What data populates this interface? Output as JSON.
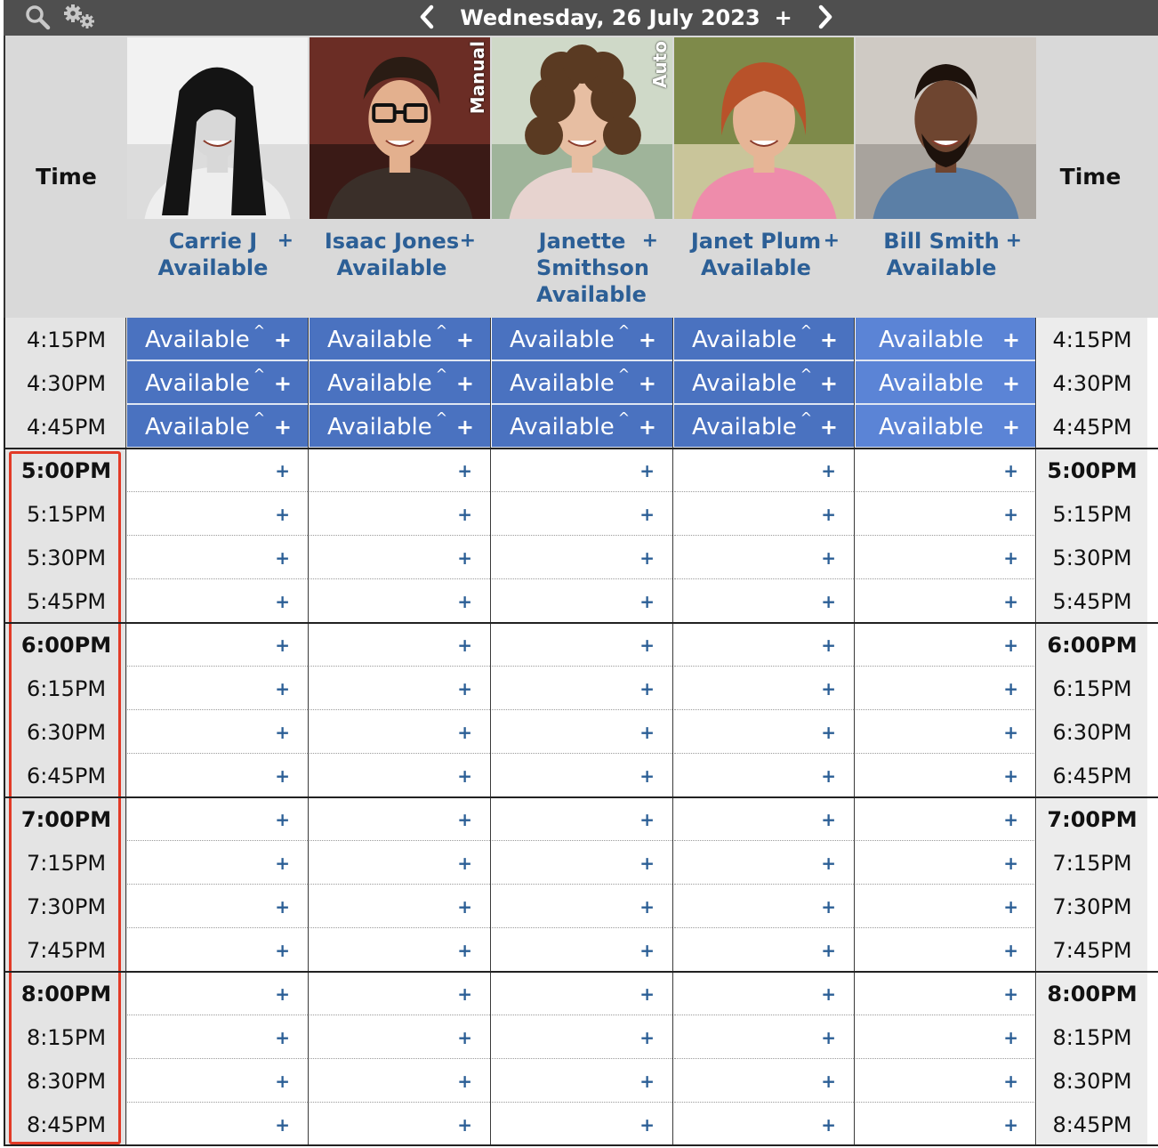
{
  "toolbar": {
    "date": "Wednesday, 26 July 2023",
    "add_label": "+",
    "prev_icon": "chevron-left-icon",
    "next_icon": "chevron-right-icon",
    "search_icon": "search-icon",
    "settings_icon": "gears-icon"
  },
  "header": {
    "time_left": "Time",
    "time_right": "Time"
  },
  "staff": [
    {
      "name": "Carrie J",
      "status": "Available",
      "tag": "",
      "plus": "+"
    },
    {
      "name": "Isaac Jones",
      "status": "Available",
      "tag": "Manual",
      "plus": "+"
    },
    {
      "name": "Janette Smithson",
      "status": "Available",
      "tag": "Auto",
      "plus": "+"
    },
    {
      "name": "Janet Plum",
      "status": "Available",
      "tag": "",
      "plus": "+"
    },
    {
      "name": "Bill Smith",
      "status": "Available",
      "tag": "",
      "plus": "+"
    }
  ],
  "slots": [
    {
      "time": "4:15PM",
      "hour": false,
      "available": true
    },
    {
      "time": "4:30PM",
      "hour": false,
      "available": true
    },
    {
      "time": "4:45PM",
      "hour": false,
      "available": true
    },
    {
      "time": "5:00PM",
      "hour": true,
      "available": false
    },
    {
      "time": "5:15PM",
      "hour": false,
      "available": false
    },
    {
      "time": "5:30PM",
      "hour": false,
      "available": false
    },
    {
      "time": "5:45PM",
      "hour": false,
      "available": false
    },
    {
      "time": "6:00PM",
      "hour": true,
      "available": false
    },
    {
      "time": "6:15PM",
      "hour": false,
      "available": false
    },
    {
      "time": "6:30PM",
      "hour": false,
      "available": false
    },
    {
      "time": "6:45PM",
      "hour": false,
      "available": false
    },
    {
      "time": "7:00PM",
      "hour": true,
      "available": false
    },
    {
      "time": "7:15PM",
      "hour": false,
      "available": false
    },
    {
      "time": "7:30PM",
      "hour": false,
      "available": false
    },
    {
      "time": "7:45PM",
      "hour": false,
      "available": false
    },
    {
      "time": "8:00PM",
      "hour": true,
      "available": false
    },
    {
      "time": "8:15PM",
      "hour": false,
      "available": false
    },
    {
      "time": "8:30PM",
      "hour": false,
      "available": false
    },
    {
      "time": "8:45PM",
      "hour": false,
      "available": false
    }
  ],
  "cell_labels": {
    "available": "Available",
    "caret": "^",
    "plus": "+"
  },
  "colors": {
    "accent": "#2c5f96",
    "available_fill": "#4a72c0",
    "available_fill_last": "#5b84d6",
    "highlight_box": "#e23a26"
  }
}
